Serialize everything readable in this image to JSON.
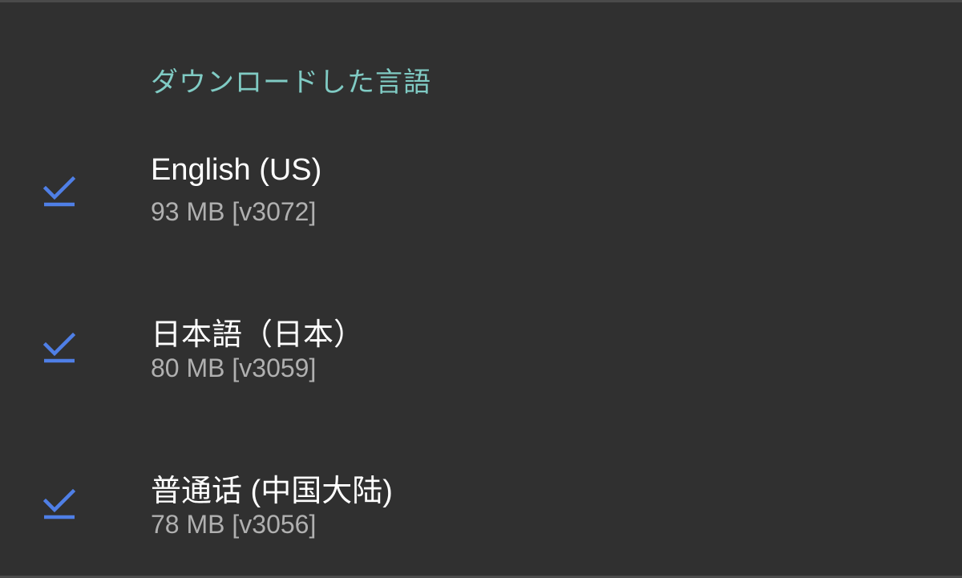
{
  "header": {
    "title": "ダウンロードした言語"
  },
  "languages": [
    {
      "name": "English (US)",
      "size": "93 MB [v3072]",
      "icon": "download-done-icon"
    },
    {
      "name": "日本語（日本）",
      "size": "80 MB [v3059]",
      "icon": "download-done-icon"
    },
    {
      "name": "普通话 (中国大陆)",
      "size": "78 MB [v3056]",
      "icon": "download-done-icon"
    }
  ],
  "colors": {
    "background": "#303030",
    "header": "#80cbc4",
    "icon": "#4f7fe6",
    "primary_text": "#ffffff",
    "secondary_text": "#b0b0b0"
  }
}
